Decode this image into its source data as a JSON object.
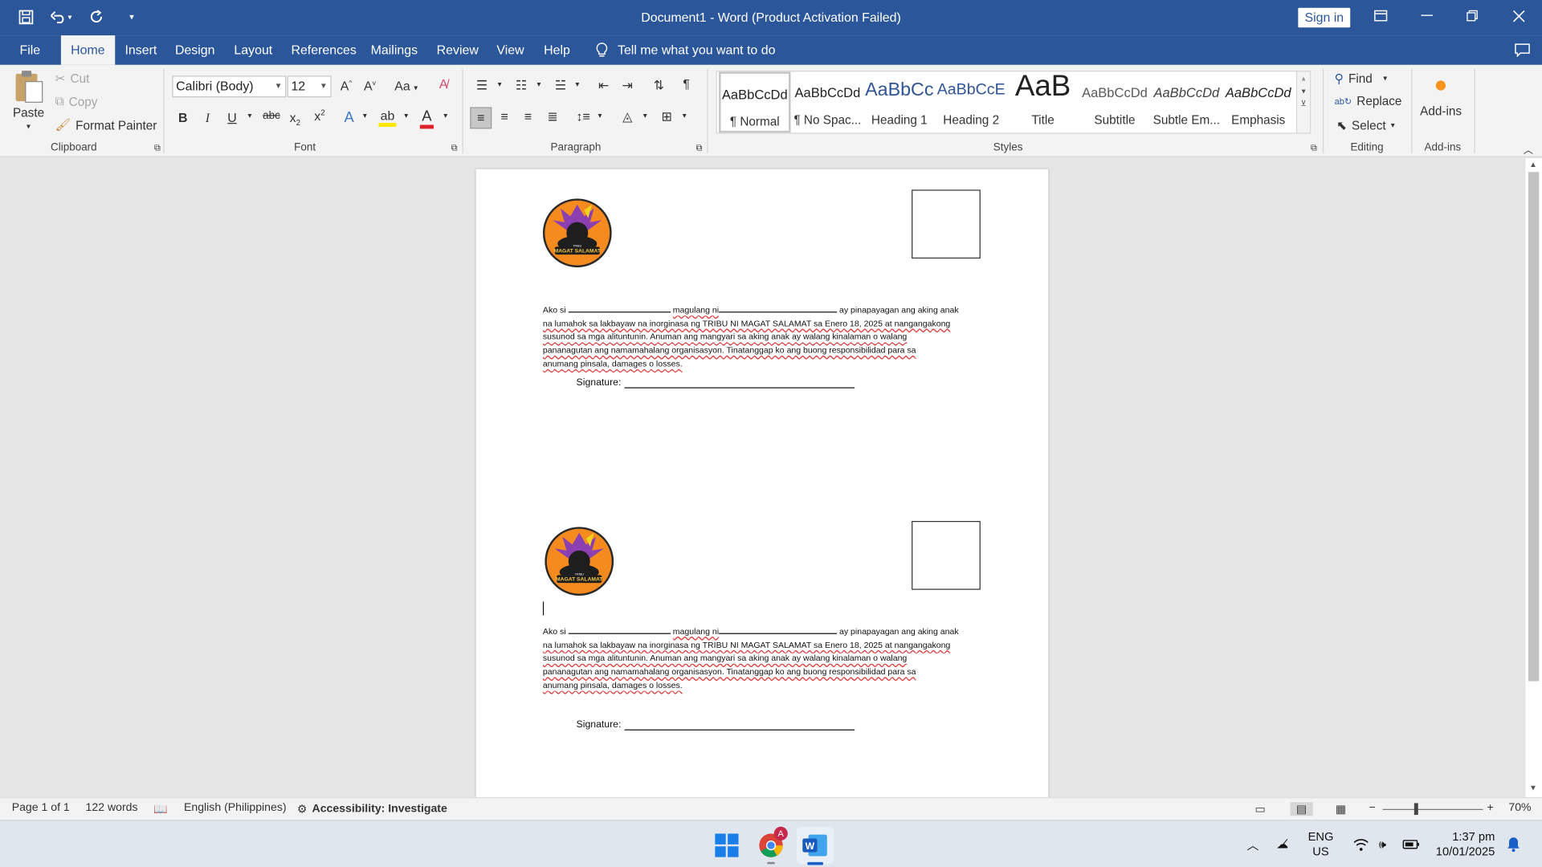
{
  "window": {
    "title": "Document1  -  Word (Product Activation Failed)",
    "sign_in": "Sign in"
  },
  "tabs": [
    "File",
    "Home",
    "Insert",
    "Design",
    "Layout",
    "References",
    "Mailings",
    "Review",
    "View",
    "Help"
  ],
  "active_tab": "Home",
  "tell_me": "Tell me what you want to do",
  "clipboard": {
    "paste": "Paste",
    "cut": "Cut",
    "copy": "Copy",
    "format_painter": "Format Painter",
    "label": "Clipboard"
  },
  "font": {
    "family": "Calibri (Body)",
    "size": "12",
    "change_case": "Aa",
    "label": "Font"
  },
  "paragraph": {
    "label": "Paragraph"
  },
  "styles": {
    "label": "Styles",
    "items": [
      {
        "preview": "AaBbCcDd",
        "name": "¶ Normal"
      },
      {
        "preview": "AaBbCcDd",
        "name": "¶ No Spac..."
      },
      {
        "preview": "AaBbCc",
        "name": "Heading 1"
      },
      {
        "preview": "AaBbCcE",
        "name": "Heading 2"
      },
      {
        "preview": "AaB",
        "name": "Title"
      },
      {
        "preview": "AaBbCcDd",
        "name": "Subtitle"
      },
      {
        "preview": "AaBbCcDd",
        "name": "Subtle Em..."
      },
      {
        "preview": "AaBbCcDd",
        "name": "Emphasis"
      }
    ]
  },
  "editing": {
    "find": "Find",
    "replace": "Replace",
    "select": "Select",
    "label": "Editing"
  },
  "addins": {
    "button": "Add-ins",
    "label": "Add-ins"
  },
  "document": {
    "logo_text": "MAGAT SALAMAT",
    "logo_small": "TRIBU",
    "para_line1_a": "Ako si",
    "para_line1_b": "magulang ni",
    "para_line1_c": "ay pinapayagan ang aking anak",
    "para_line2": "na lumahok sa lakbayaw na inorginasa ng TRIBU NI MAGAT SALAMAT sa Enero 18, 2025 at nangangakong",
    "para_line3": "susunod sa mga alituntunin. Anuman ang mangyari sa aking anak ay walang kinalaman o walang",
    "para_line4": "pananagutan  ang namamahalang organisasyon. Tinatanggap ko ang buong responsibilidad para sa",
    "para_line5": "anumang pinsala, damages o losses.",
    "signature_label": "Signature:"
  },
  "status": {
    "page": "Page 1 of 1",
    "words": "122 words",
    "language": "English (Philippines)",
    "accessibility": "Accessibility: Investigate",
    "zoom": "70%"
  },
  "taskbar": {
    "lang_top": "ENG",
    "lang_bottom": "US",
    "time": "1:37 pm",
    "date": "10/01/2025",
    "chrome_badge": "A"
  },
  "colors": {
    "word_blue": "#2b579a",
    "ribbon_bg": "#f3f3f3",
    "logo_orange": "#f58a1f"
  }
}
